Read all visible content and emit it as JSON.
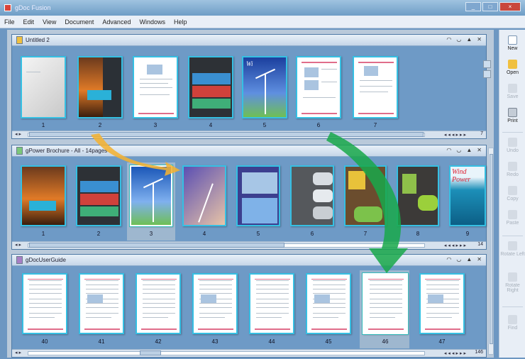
{
  "window": {
    "title": "gDoc Fusion",
    "controls": [
      "_",
      "□",
      "×"
    ]
  },
  "menu": [
    "File",
    "Edit",
    "View",
    "Document",
    "Advanced",
    "Windows",
    "Help"
  ],
  "toolbar": [
    {
      "label": "New",
      "icon": "new-icon",
      "enabled": true
    },
    {
      "label": "Open",
      "icon": "open-icon",
      "enabled": true
    },
    {
      "label": "Save",
      "icon": "save-icon",
      "enabled": false
    },
    {
      "label": "Print",
      "icon": "print-icon",
      "enabled": true
    },
    {
      "label": "Undo",
      "icon": "undo-icon",
      "enabled": false
    },
    {
      "label": "Redo",
      "icon": "redo-icon",
      "enabled": false
    },
    {
      "label": "Copy",
      "icon": "copy-icon",
      "enabled": false
    },
    {
      "label": "Paste",
      "icon": "paste-icon",
      "enabled": false
    },
    {
      "label": "Rotate Left",
      "icon": "rotate-left-icon",
      "enabled": false
    },
    {
      "label": "Rotate Right",
      "icon": "rotate-right-icon",
      "enabled": false
    },
    {
      "label": "Find",
      "icon": "find-icon",
      "enabled": false
    }
  ],
  "panels": [
    {
      "title": "Untitled 2",
      "pages": [
        "1",
        "2",
        "3",
        "4",
        "5",
        "6",
        "7"
      ],
      "page_count": "7"
    },
    {
      "title": "gPower Brochure - All - 14pages",
      "pages": [
        "1",
        "2",
        "3",
        "4",
        "5",
        "6",
        "7",
        "8",
        "9"
      ],
      "page_count": "14",
      "selected_page": "3"
    },
    {
      "title": "gDocUserGuide",
      "pages": [
        "40",
        "41",
        "42",
        "43",
        "44",
        "45",
        "46",
        "47"
      ],
      "page_count": "146",
      "selected_page": "46"
    }
  ],
  "colors": {
    "accent": "#36c0e3",
    "panel_bg": "#6e9ac6",
    "arrow_yellow": "#f2b233",
    "arrow_green": "#19a84a"
  },
  "page_text": {
    "wind_power": "Wind Power"
  }
}
